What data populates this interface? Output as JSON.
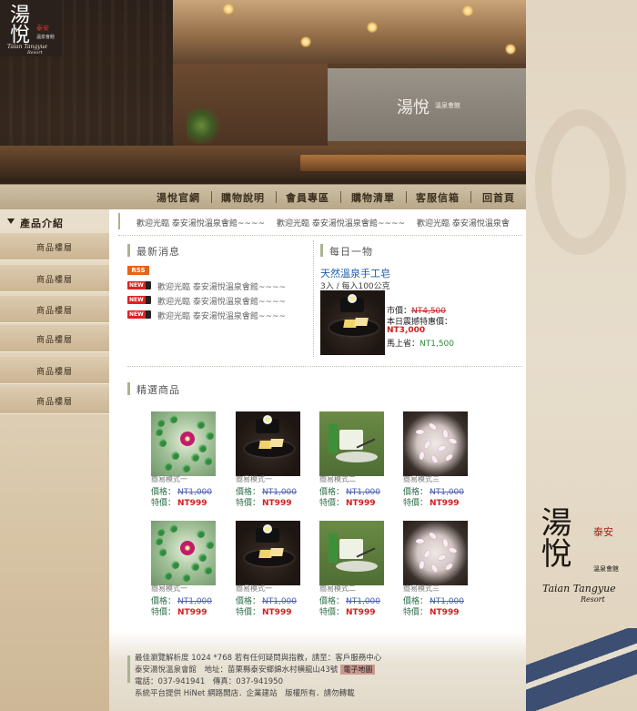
{
  "hero": {
    "logo_text": "湯悅",
    "logo_red": "泰安",
    "logo_sub": "溫泉會館",
    "logo_en": "Taian Tangyue",
    "logo_en2": "Resort",
    "wall_sign": "湯悅",
    "wall_sign_sub": "溫泉會館"
  },
  "nav": {
    "items": [
      {
        "label": "湯悅官網"
      },
      {
        "label": "購物說明"
      },
      {
        "label": "會員專區"
      },
      {
        "label": "購物清單"
      },
      {
        "label": "客服信箱"
      },
      {
        "label": "回首頁"
      }
    ]
  },
  "sidebar": {
    "title": "產品介紹",
    "items": [
      {
        "label": "商品樓層"
      },
      {
        "label": "商品樓層"
      },
      {
        "label": "商品樓層"
      },
      {
        "label": "商品樓層"
      },
      {
        "label": "商品樓層"
      },
      {
        "label": "商品樓層"
      }
    ]
  },
  "marquee": {
    "items": [
      "歡迎光臨 泰安湯悅溫泉會館~~~~",
      "歡迎光臨 泰安湯悅溫泉會館~~~~",
      "歡迎光臨 泰安湯悅溫泉會"
    ]
  },
  "news": {
    "title": "最新消息",
    "rss": "RSS",
    "new_tag": "NEW",
    "items": [
      "歡迎光臨 泰安湯悅溫泉會館~~~~",
      "歡迎光臨 泰安湯悅溫泉會館~~~~",
      "歡迎光臨 泰安湯悅溫泉會館~~~~"
    ]
  },
  "daily": {
    "title": "每日一物",
    "name": "天然溫泉手工皂",
    "spec": "3入 / 每入100公克",
    "market_label": "市價：",
    "market_price": "NT4,500",
    "special_label": "本日震撼特惠價：",
    "special_price": "NT3,000",
    "save_label": "馬上省：",
    "save_price": "NT1,500"
  },
  "featured": {
    "title": "精選商品",
    "price_label": "價格：",
    "special_label": "特價：",
    "products": [
      {
        "name": "簡易模式一",
        "price": "NT1,000",
        "special": "NT999",
        "thumb": "glass"
      },
      {
        "name": "簡易模式一",
        "price": "NT1,000",
        "special": "NT999",
        "thumb": "soap"
      },
      {
        "name": "簡易模式二",
        "price": "NT1,000",
        "special": "NT999",
        "thumb": "green"
      },
      {
        "name": "簡易模式三",
        "price": "NT1,000",
        "special": "NT999",
        "thumb": "petal"
      },
      {
        "name": "簡易模式一",
        "price": "NT1,000",
        "special": "NT999",
        "thumb": "glass"
      },
      {
        "name": "簡易模式一",
        "price": "NT1,000",
        "special": "NT999",
        "thumb": "soap"
      },
      {
        "name": "簡易模式二",
        "price": "NT1,000",
        "special": "NT999",
        "thumb": "green"
      },
      {
        "name": "簡易模式三",
        "price": "NT1,000",
        "special": "NT999",
        "thumb": "petal"
      }
    ]
  },
  "footer": {
    "line1": "最佳瀏覽解析度 1024 *768 若有任何疑問與指教，請至：客戶服務中心",
    "line2": "泰安湯悅溫泉會館　地址：苗栗縣泰安鄉錦水村横龍山43號",
    "map_button": "電子地圖",
    "line3": "電話：037-941941　傳真：037-941950",
    "line4": "系統平台提供 HiNet 網路開店．企業建站　版權所有．請勿轉載"
  },
  "right_panel": {
    "brand": "湯悅",
    "brand_red": "泰安",
    "brand_sub": "溫泉會館",
    "brand_en": "Taian Tangyue",
    "brand_en2": "Resort"
  },
  "colors": {
    "accent_bar": "#a9b48c",
    "link_blue": "#1e5ea8",
    "price_red": "#d21d1d",
    "price_green": "#2e6e4a",
    "old_price_blue": "#4c5fb0",
    "rss_orange": "#e8621b"
  }
}
